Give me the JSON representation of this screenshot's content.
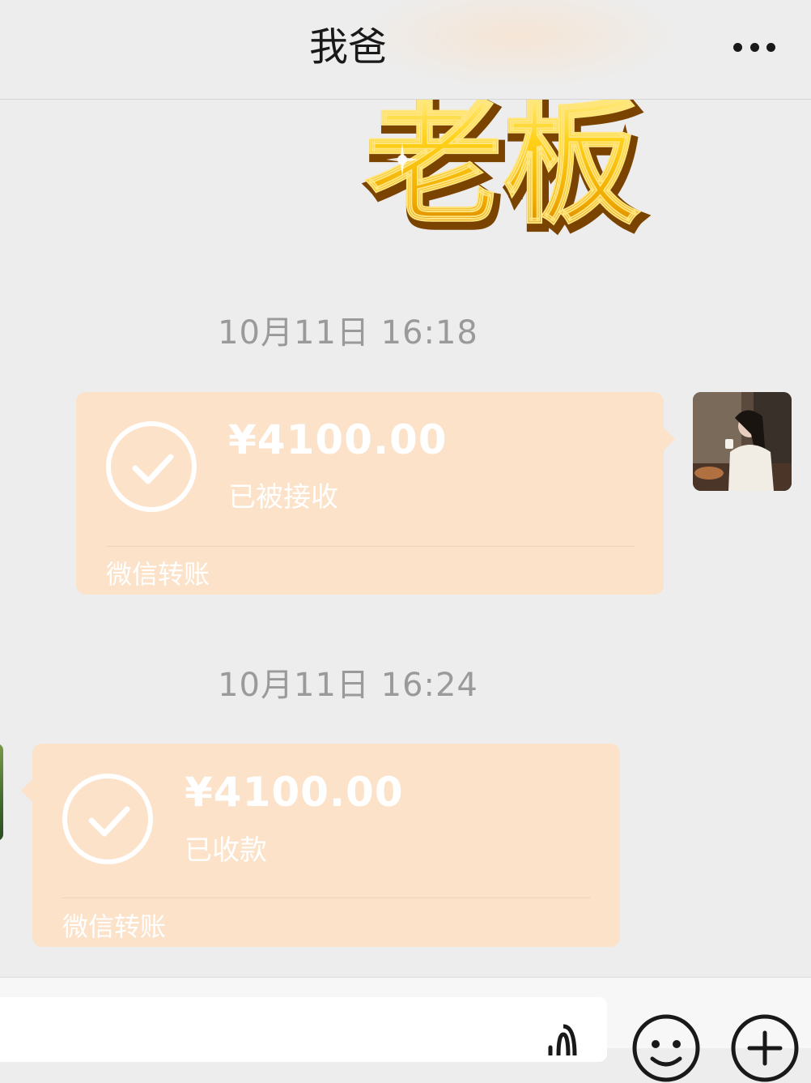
{
  "header": {
    "title": "我爸",
    "more_icon": "more-dots-icon"
  },
  "sticker": {
    "text": "老板"
  },
  "messages": [
    {
      "timestamp": "10月11日 16:18",
      "side": "right",
      "amount": "¥4100.00",
      "status": "已被接收",
      "footer": "微信转账"
    },
    {
      "timestamp": "10月11日 16:24",
      "side": "left",
      "amount": "¥4100.00",
      "status": "已收款",
      "footer": "微信转账"
    }
  ],
  "colors": {
    "card": "#fbe2c9",
    "background": "#ededed",
    "sticker_gold": "#f5b800"
  },
  "input_bar": {
    "icons": [
      "voice-icon",
      "emoji-icon",
      "plus-icon"
    ]
  }
}
